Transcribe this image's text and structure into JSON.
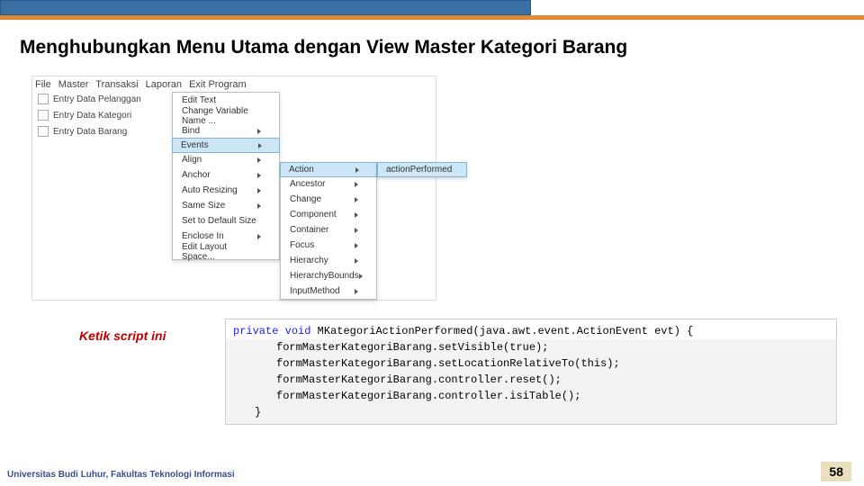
{
  "title": "Menghubungkan Menu Utama dengan View Master Kategori Barang",
  "menubar": [
    "File",
    "Master",
    "Transaksi",
    "Laporan",
    "Exit Program"
  ],
  "drop_items": [
    "Entry Data Pelanggan",
    "Entry Data Kategori",
    "Entry Data Barang"
  ],
  "submenu1": {
    "items_top": [
      "Edit Text",
      "Change Variable Name ...",
      "Bind"
    ],
    "highlight": "Events",
    "items_bottom": [
      "Align",
      "Anchor",
      "Auto Resizing",
      "Same Size",
      "Set to Default Size",
      "Enclose In",
      "Edit Layout Space..."
    ]
  },
  "submenu2": [
    "Action",
    "Ancestor",
    "Change",
    "Component",
    "Container",
    "Focus",
    "Hierarchy",
    "HierarchyBounds",
    "InputMethod"
  ],
  "submenu3_item": "actionPerformed",
  "script_label": "Ketik script ini",
  "code": {
    "sig_kw1": "private",
    "sig_kw2": "void",
    "sig_name": "MKategoriActionPerformed(java.awt.event.ActionEvent evt) {",
    "lines": [
      "formMasterKategoriBarang.setVisible(true);",
      "formMasterKategoriBarang.setLocationRelativeTo(this);",
      "formMasterKategoriBarang.controller.reset();",
      "formMasterKategoriBarang.controller.isiTable();"
    ],
    "close": "}"
  },
  "footer": "Universitas Budi Luhur, Fakultas Teknologi Informasi",
  "page_number": "58"
}
